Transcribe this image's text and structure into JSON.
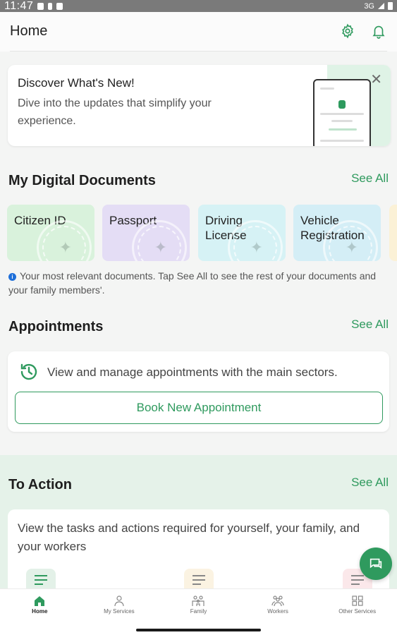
{
  "status_bar": {
    "time": "11:47",
    "network": "3G"
  },
  "header": {
    "title": "Home",
    "settings_icon": "gear-icon",
    "notifications_icon": "bell-icon"
  },
  "discover": {
    "title": "Discover What's New!",
    "description": "Dive into the updates that simplify your experience."
  },
  "documents": {
    "title": "My Digital Documents",
    "see_all": "See All",
    "items": [
      {
        "label": "Citizen ID",
        "color": "#d9f2dc"
      },
      {
        "label": "Passport",
        "color": "#e4ddf5"
      },
      {
        "label": "Driving License",
        "color": "#d6f2f5"
      },
      {
        "label": "Vehicle Registration",
        "color": "#d4eef6"
      }
    ],
    "note": "Your most relevant documents. Tap See All to see the rest of your documents and your family members'."
  },
  "appointments": {
    "title": "Appointments",
    "see_all": "See All",
    "description": "View and manage appointments with the main sectors.",
    "book_label": "Book New Appointment"
  },
  "to_action": {
    "title": "To Action",
    "see_all": "See All",
    "description": "View the tasks and actions required for yourself, your family, and your workers"
  },
  "bottom_nav": [
    {
      "label": "Home",
      "icon": "home-icon",
      "active": true
    },
    {
      "label": "My Services",
      "icon": "person-icon",
      "active": false
    },
    {
      "label": "Family",
      "icon": "family-icon",
      "active": false
    },
    {
      "label": "Workers",
      "icon": "workers-icon",
      "active": false
    },
    {
      "label": "Other Services",
      "icon": "grid-icon",
      "active": false
    }
  ],
  "colors": {
    "accent": "#2f9a5e",
    "action_bg": "#e5f2e9"
  }
}
